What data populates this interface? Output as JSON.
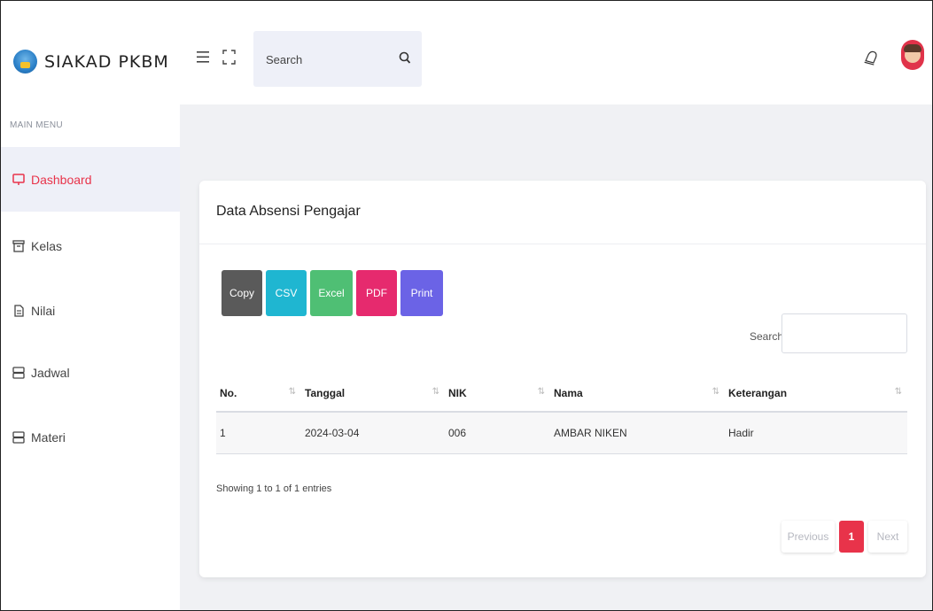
{
  "app": {
    "brand": "SIAKAD PKBM"
  },
  "header": {
    "search_placeholder": "Search"
  },
  "sidebar": {
    "heading": "MAIN MENU",
    "items": [
      {
        "label": "Dashboard",
        "icon": "monitor-icon",
        "active": true
      },
      {
        "label": "Kelas",
        "icon": "archive-icon",
        "active": false
      },
      {
        "label": "Nilai",
        "icon": "file-icon",
        "active": false
      },
      {
        "label": "Jadwal",
        "icon": "server-icon",
        "active": false
      },
      {
        "label": "Materi",
        "icon": "server-icon",
        "active": false
      }
    ]
  },
  "card": {
    "title": "Data Absensi Pengajar",
    "buttons": [
      {
        "label": "Copy",
        "color": "#5a5a5a"
      },
      {
        "label": "CSV",
        "color": "#1fb6d1"
      },
      {
        "label": "Excel",
        "color": "#4fbf74"
      },
      {
        "label": "PDF",
        "color": "#e62a6e"
      },
      {
        "label": "Print",
        "color": "#6b63e6"
      }
    ],
    "search_label": "Search:",
    "table": {
      "columns": [
        "No.",
        "Tanggal",
        "NIK",
        "Nama",
        "Keterangan"
      ],
      "rows": [
        [
          "1",
          "2024-03-04",
          "006",
          "AMBAR NIKEN",
          "Hadir"
        ]
      ]
    },
    "info": "Showing 1 to 1 of 1 entries",
    "pagination": {
      "previous": "Previous",
      "current": "1",
      "next": "Next"
    }
  },
  "colors": {
    "accent": "#e8334a",
    "active_bg": "#eef0f8"
  }
}
